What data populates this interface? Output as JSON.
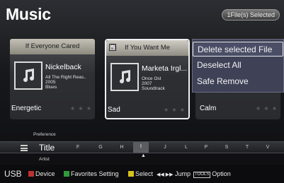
{
  "app": {
    "title": "Music",
    "selected_status": "1File(s) Selected"
  },
  "cards": [
    {
      "header": "If Everyone Cared",
      "artist": "Nickelback",
      "album": "All The Right Reas..",
      "year": "2005",
      "genre": "Blues",
      "mood": "Energetic",
      "stars": "★ ★ ★",
      "checked": false,
      "focused": false
    },
    {
      "header": "If You Want Me",
      "artist": "Marketa Irgl...",
      "album": "Once Ost",
      "year": "2007",
      "genre": "Soundtrack",
      "mood": "Sad",
      "stars": "★ ★ ★",
      "checked": true,
      "focused": true
    },
    {
      "header": "",
      "artist": "",
      "album": "",
      "year": "",
      "genre": "",
      "mood": "Calm",
      "stars": "★ ★ ★",
      "checked": false,
      "focused": false
    }
  ],
  "checkbox_mark": "☑",
  "context_menu": {
    "items": [
      "Delete selected File",
      "Deselect All",
      "Safe Remove"
    ],
    "active_index": 0
  },
  "sort": {
    "above": "Preference",
    "current": "Title",
    "below": "Artist",
    "letters": [
      "F",
      "G",
      "H",
      "I",
      "J",
      "L",
      "P",
      "S",
      "T",
      "V"
    ],
    "current_letter": "I",
    "caret": "▲"
  },
  "footer": {
    "source": "USB",
    "device": "Device",
    "favorites": "Favorites Setting",
    "select": "Select",
    "jump_arrows": "◀◀ ▶▶",
    "jump": "Jump",
    "tools": "TOOLS",
    "option": "Option"
  },
  "colors": {
    "menu_bg": "#3f4257",
    "button_red": "#c03030",
    "button_green": "#2f9a3a",
    "button_yellow": "#d8c21e",
    "button_blue": "#2f5fd0"
  }
}
